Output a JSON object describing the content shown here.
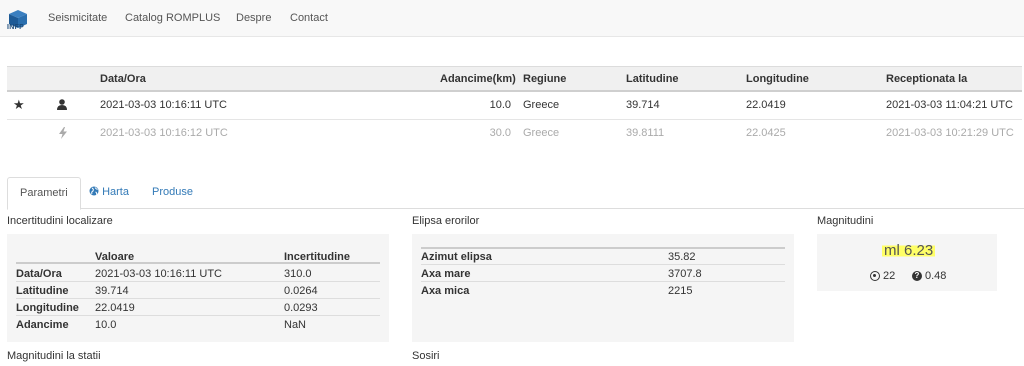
{
  "nav": {
    "logo_text": "INFP",
    "items": [
      "Seismicitate",
      "Catalog ROMPLUS",
      "Despre",
      "Contact"
    ]
  },
  "events": {
    "headers": [
      "Data/Ora",
      "Adancime(km)",
      "Regiune",
      "Latitudine",
      "Longitudine",
      "Receptionata la"
    ],
    "rows": [
      {
        "time": "2021-03-03 10:16:11 UTC",
        "depth": "10.0",
        "region": "Greece",
        "lat": "39.714",
        "lon": "22.0419",
        "received": "2021-03-03 11:04:21 UTC"
      },
      {
        "time": "2021-03-03 10:16:12 UTC",
        "depth": "30.0",
        "region": "Greece",
        "lat": "39.8111",
        "lon": "22.0425",
        "received": "2021-03-03 10:21:29 UTC"
      }
    ]
  },
  "tabs": [
    "Parametri",
    "Harta",
    "Produse"
  ],
  "location_uncertainty": {
    "title": "Incertitudini localizare",
    "headers": [
      "Valoare",
      "Incertitudine"
    ],
    "rows": [
      {
        "label": "Data/Ora",
        "value": "2021-03-03 10:16:11 UTC",
        "unc": "310.0"
      },
      {
        "label": "Latitudine",
        "value": "39.714",
        "unc": "0.0264"
      },
      {
        "label": "Longitudine",
        "value": "22.0419",
        "unc": "0.0293"
      },
      {
        "label": "Adancime",
        "value": "10.0",
        "unc": "NaN"
      }
    ]
  },
  "ellipse": {
    "title": "Elipsa erorilor",
    "rows": [
      {
        "label": "Azimut elipsa",
        "value": "35.82"
      },
      {
        "label": "Axa mare",
        "value": "3707.8"
      },
      {
        "label": "Axa mica",
        "value": "2215"
      }
    ]
  },
  "magnitude": {
    "title": "Magnitudini",
    "value": "ml 6.23",
    "stations": "22",
    "uncertainty": "0.48"
  },
  "sections": {
    "station_mag": "Magnitudini la statii",
    "arrivals": "Sosiri"
  },
  "colors": {
    "link": "#337ab7",
    "highlight": "#ffff66"
  }
}
